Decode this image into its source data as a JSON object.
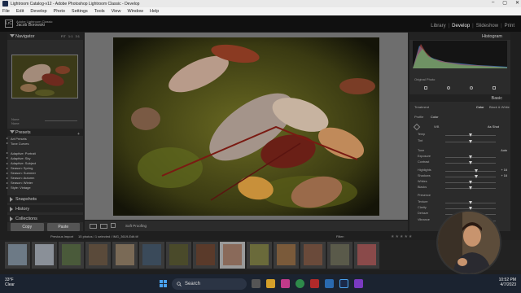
{
  "window": {
    "title": "Lightroom Catalog-v12 - Adobe Photoshop Lightroom Classic - Develop",
    "controls": [
      "–",
      "▢",
      "✕"
    ]
  },
  "menu": [
    "File",
    "Edit",
    "Develop",
    "Photo",
    "Settings",
    "Tools",
    "View",
    "Window",
    "Help"
  ],
  "identity_plate": {
    "logo": "LrC",
    "line1": "Adobe Lightroom Classic",
    "line2": "Jacob Borowski"
  },
  "modules": {
    "items": [
      "Library",
      "Develop",
      "Slideshow",
      "Print"
    ],
    "active": "Develop",
    "separator": "|"
  },
  "left_panel": {
    "navigator": {
      "title": "Navigator",
      "options": [
        "FIT",
        "1:1",
        "3:1"
      ]
    },
    "nav_info": [
      "None",
      "None"
    ],
    "presets": {
      "title": "Presets"
    },
    "preset_items": [
      "Art Presets",
      "Tone Curves",
      "",
      "Adaptive: Portrait",
      "Adaptive: Sky",
      "Adaptive: Subject",
      "Season: Spring",
      "Season: Summer",
      "Season: Autumn",
      "Season: Winter",
      "Style: Vintage"
    ],
    "snapshots": {
      "title": "Snapshots"
    },
    "history": {
      "title": "History"
    },
    "collections": {
      "title": "Collections"
    },
    "copy_button": "Copy",
    "paste_button": "Paste"
  },
  "toolbar": {
    "soft_proofing": "Soft Proofing"
  },
  "right_panel": {
    "histogram": {
      "title": "Histogram"
    },
    "original_photo": "Original Photo",
    "basic": {
      "title": "Basic"
    },
    "treatment_label": "Treatment",
    "treatment_options": [
      "Color",
      "Black & White"
    ],
    "profile_label": "Profile",
    "profile_value": "Color",
    "wb_label": "WB",
    "wb_value": "As Shot",
    "sliders": [
      {
        "label": "Temp",
        "value": ""
      },
      {
        "label": "Tint",
        "value": ""
      },
      {
        "label": "Tone",
        "value": "Auto"
      },
      {
        "label": "Exposure",
        "value": ""
      },
      {
        "label": "Contrast",
        "value": ""
      },
      {
        "label": "Highlights",
        "value": "+ 16"
      },
      {
        "label": "Shadows",
        "value": "+ 16"
      },
      {
        "label": "Whites",
        "value": ""
      },
      {
        "label": "Blacks",
        "value": ""
      },
      {
        "label": "Presence",
        "value": ""
      },
      {
        "label": "Texture",
        "value": ""
      },
      {
        "label": "Clarity",
        "value": ""
      },
      {
        "label": "Dehaze",
        "value": ""
      },
      {
        "label": "Vibrance",
        "value": ""
      }
    ]
  },
  "filmstrip": {
    "bar_text": [
      "Previous Import",
      "15 photos / 1 selected / IMG_3619-Edit.tif"
    ],
    "filter_label": "Filter:",
    "thumbnail_count": 14,
    "selected_index": 8
  },
  "taskbar": {
    "weather_temp": "33°F",
    "weather_desc": "Clear",
    "search_placeholder": "Search",
    "time": "10:52 PM",
    "date": "4/7/2023"
  },
  "colors": {
    "accent": "#4aa3f0",
    "panel": "#2b2b2b",
    "workspace": "#6e6e6e"
  }
}
